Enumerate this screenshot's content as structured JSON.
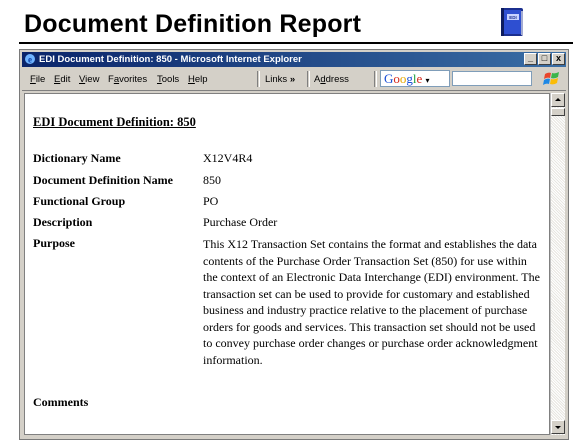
{
  "slide": {
    "title": "Document Definition Report",
    "icon": "edi-book-icon"
  },
  "window": {
    "title": "EDI Document Definition: 850 - Microsoft Internet Explorer",
    "controls": {
      "minimize": "_",
      "maximize": "□",
      "close": "x"
    }
  },
  "menubar": {
    "items": [
      {
        "label": "File",
        "hotkey": "F",
        "rest": "ile"
      },
      {
        "label": "Edit",
        "hotkey": "E",
        "rest": "dit"
      },
      {
        "label": "View",
        "hotkey": "V",
        "rest": "iew"
      },
      {
        "label": "Favorites",
        "hotkey": "a",
        "pre": "F",
        "rest": "vorites"
      },
      {
        "label": "Tools",
        "hotkey": "T",
        "rest": "ools"
      },
      {
        "label": "Help",
        "hotkey": "H",
        "rest": "elp"
      }
    ],
    "links_label": "Links",
    "links_chevron": "»",
    "address_label": "Address",
    "address_hotkey": "d",
    "google": {
      "letters": [
        "G",
        "o",
        "o",
        "g",
        "l",
        "e"
      ],
      "dropdown": "▾"
    }
  },
  "document": {
    "heading": "EDI Document Definition: 850",
    "fields": [
      {
        "label": "Dictionary Name",
        "value": "X12V4R4"
      },
      {
        "label": "Document Definition Name",
        "value": "850"
      },
      {
        "label": "Functional Group",
        "value": "PO"
      },
      {
        "label": "Description",
        "value": "Purchase Order"
      },
      {
        "label": "Purpose",
        "value": ""
      },
      {
        "label": "Comments",
        "value": ""
      }
    ],
    "purpose_text": "This X12 Transaction Set contains the format and establishes the data contents of the Purchase Order Transaction Set (850) for use within the context of an Electronic Data Interchange (EDI) environment. The transaction set can be used to provide for customary and established business and industry practice relative to the placement of purchase orders for goods and services. This transaction set should not be used to convey purchase order changes or purchase order acknowledgment information."
  },
  "colors": {
    "titlebar_start": "#0a246a",
    "titlebar_end": "#3a6ea5",
    "chrome": "#d4d0c8"
  }
}
